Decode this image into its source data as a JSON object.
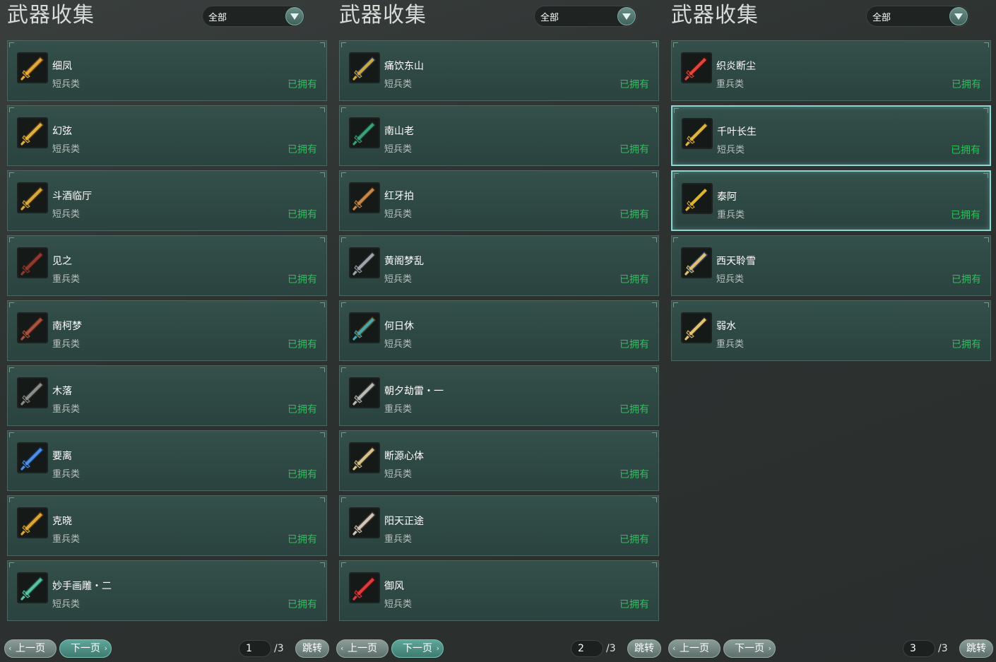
{
  "panels": [
    {
      "title": "武器收集",
      "filter": "全部",
      "items": [
        {
          "name": "细凤",
          "type": "短兵类",
          "status": "已拥有",
          "icon": "golden-sword-icon",
          "c1": "#e2a83a",
          "c2": "#6b4510"
        },
        {
          "name": "幻弦",
          "type": "短兵类",
          "status": "已拥有",
          "icon": "golden-ornate-sword-icon",
          "c1": "#e0b040",
          "c2": "#5a3a10"
        },
        {
          "name": "斗酒临厅",
          "type": "短兵类",
          "status": "已拥有",
          "icon": "golden-ornate-sword-icon",
          "c1": "#d9a83a",
          "c2": "#4f3510"
        },
        {
          "name": "见之",
          "type": "重兵类",
          "status": "已拥有",
          "icon": "red-blade-icon",
          "c1": "#8f3a30",
          "c2": "#3a1814"
        },
        {
          "name": "南柯梦",
          "type": "重兵类",
          "status": "已拥有",
          "icon": "red-rock-blade-icon",
          "c1": "#a8533f",
          "c2": "#4b2018"
        },
        {
          "name": "木落",
          "type": "重兵类",
          "status": "已拥有",
          "icon": "iron-greatsword-icon",
          "c1": "#8c8c88",
          "c2": "#2a2a28"
        },
        {
          "name": "要离",
          "type": "重兵类",
          "status": "已拥有",
          "icon": "blue-blade-icon",
          "c1": "#4d8fe0",
          "c2": "#13305e"
        },
        {
          "name": "克晓",
          "type": "重兵类",
          "status": "已拥有",
          "icon": "gold-blade-icon",
          "c1": "#d9a837",
          "c2": "#54380c"
        },
        {
          "name": "妙手画雕・二",
          "type": "短兵类",
          "status": "已拥有",
          "icon": "jade-dagger-icon",
          "c1": "#58c2a0",
          "c2": "#1b4d40"
        }
      ],
      "pager": {
        "prev": "上一页",
        "next": "下一页",
        "page": "1",
        "total": "/3",
        "jump": "跳转",
        "active": "next"
      }
    },
    {
      "title": "武器收集",
      "filter": "全部",
      "items": [
        {
          "name": "痛饮东山",
          "type": "短兵类",
          "status": "已拥有",
          "icon": "blue-gold-sword-icon",
          "c1": "#d2a83c",
          "c2": "#243e5a"
        },
        {
          "name": "南山老",
          "type": "短兵类",
          "status": "已拥有",
          "icon": "green-dagger-icon",
          "c1": "#3aa07a",
          "c2": "#173528"
        },
        {
          "name": "红牙拍",
          "type": "短兵类",
          "status": "已拥有",
          "icon": "bronze-dagger-icon",
          "c1": "#c4884a",
          "c2": "#3e2612"
        },
        {
          "name": "黄阁梦乱",
          "type": "短兵类",
          "status": "已拥有",
          "icon": "axe-icon",
          "c1": "#a0a4a8",
          "c2": "#2c2c30"
        },
        {
          "name": "何日休",
          "type": "短兵类",
          "status": "已拥有",
          "icon": "teal-gold-sword-icon",
          "c1": "#3fa7b5",
          "c2": "#5a4612"
        },
        {
          "name": "朝夕劫雷・一",
          "type": "重兵类",
          "status": "已拥有",
          "icon": "twin-blade-icon",
          "c1": "#b8b8b4",
          "c2": "#3a3a38"
        },
        {
          "name": "断源心体",
          "type": "短兵类",
          "status": "已拥有",
          "icon": "ornate-silver-sword-icon",
          "c1": "#d6c28a",
          "c2": "#3b3428"
        },
        {
          "name": "阳天正途",
          "type": "重兵类",
          "status": "已拥有",
          "icon": "silver-blade-icon",
          "c1": "#cfc6b8",
          "c2": "#4a3a32"
        },
        {
          "name": "御风",
          "type": "短兵类",
          "status": "已拥有",
          "icon": "crimson-sword-icon",
          "c1": "#e03b3b",
          "c2": "#4e0d12"
        }
      ],
      "pager": {
        "prev": "上一页",
        "next": "下一页",
        "page": "2",
        "total": "/3",
        "jump": "跳转",
        "active": "next"
      }
    },
    {
      "title": "武器收集",
      "filter": "全部",
      "items": [
        {
          "name": "织炎断尘",
          "type": "重兵类",
          "status": "已拥有",
          "icon": "flame-blade-icon",
          "c1": "#e0473a",
          "c2": "#4a0e0e",
          "hl": false
        },
        {
          "name": "千叶长生",
          "type": "短兵类",
          "status": "已拥有",
          "icon": "gold-staff-icon",
          "c1": "#e2b43a",
          "c2": "#2a2414",
          "hl": true
        },
        {
          "name": "泰阿",
          "type": "重兵类",
          "status": "已拥有",
          "icon": "black-gold-sword-icon",
          "c1": "#e0b628",
          "c2": "#16161a",
          "hl": true
        },
        {
          "name": "西天聆雪",
          "type": "短兵类",
          "status": "已拥有",
          "icon": "trident-icon",
          "c1": "#e2c26a",
          "c2": "#3a4a74",
          "hl": false
        },
        {
          "name": "弱水",
          "type": "重兵类",
          "status": "已拥有",
          "icon": "gold-edge-blade-icon",
          "c1": "#e6c26a",
          "c2": "#2a2a26",
          "hl": false
        }
      ],
      "pager": {
        "prev": "上一页",
        "next": "下一页",
        "page": "3",
        "total": "/3",
        "jump": "跳转",
        "active": "none"
      }
    }
  ]
}
